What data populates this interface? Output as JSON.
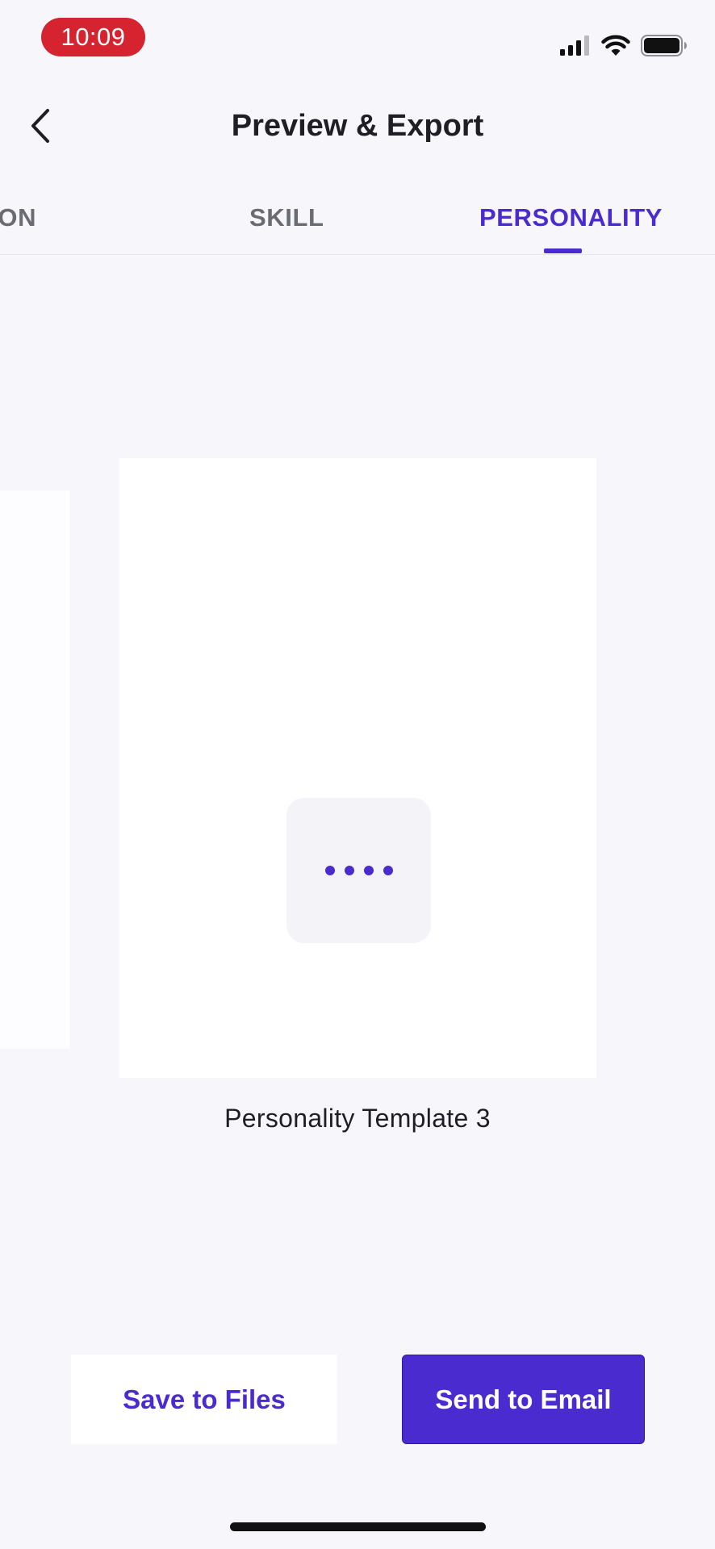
{
  "status_bar": {
    "time": "10:09",
    "icons": [
      "cellular-signal-icon",
      "wifi-icon",
      "battery-icon"
    ]
  },
  "nav": {
    "title": "Preview & Export",
    "back_icon": "chevron-left-icon"
  },
  "tabs": [
    {
      "label": "ATION",
      "active": false
    },
    {
      "label": "SKILL",
      "active": false
    },
    {
      "label": "PERSONALITY",
      "active": true
    }
  ],
  "preview": {
    "template_name": "Personality Template 3",
    "loading_icon": "loading-dots-icon"
  },
  "actions": {
    "save_label": "Save to Files",
    "email_label": "Send to Email"
  },
  "colors": {
    "accent": "#4a2bd0",
    "background": "#f7f7fb",
    "time_pill": "#d5232f"
  }
}
